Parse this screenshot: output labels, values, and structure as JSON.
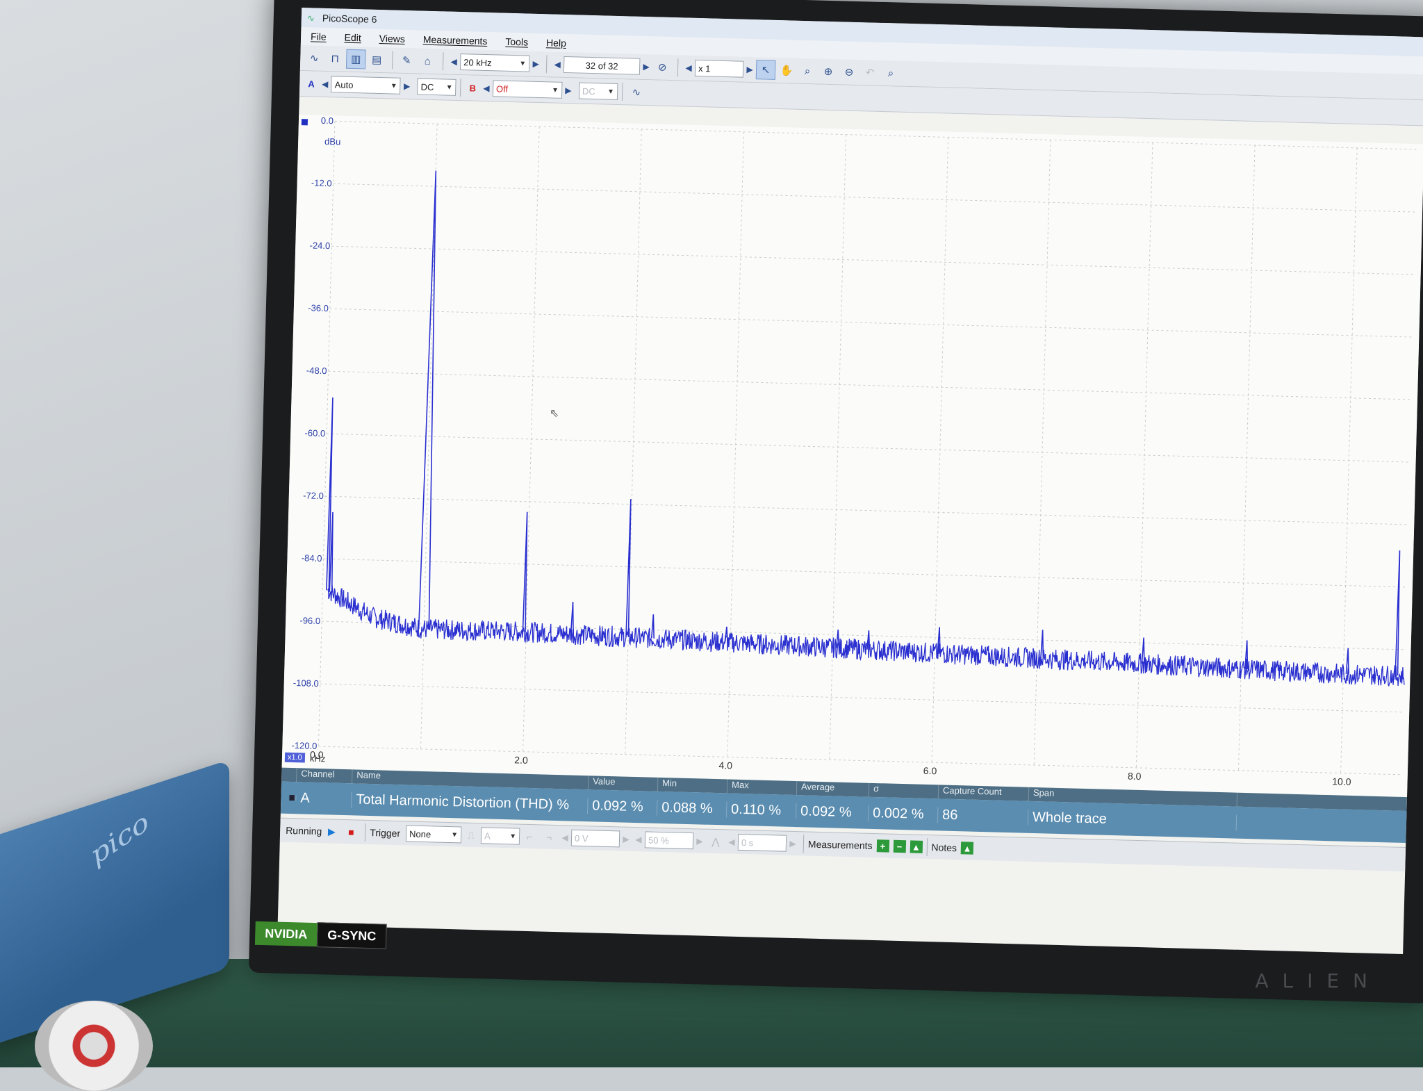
{
  "window": {
    "title": "PicoScope 6"
  },
  "menu": [
    "File",
    "Edit",
    "Views",
    "Measurements",
    "Tools",
    "Help"
  ],
  "toolbar": {
    "timebase": "20 kHz",
    "capture_index": "32 of 32",
    "zoom": "x 1",
    "channel_a_label": "A",
    "channel_a_range": "Auto",
    "channel_a_coupling": "DC",
    "channel_b_label": "B",
    "channel_b_range": "Off",
    "channel_b_coupling": "DC"
  },
  "plot": {
    "y_unit": "dBu",
    "x_unit": "kHz",
    "scale_tag": "x1.0",
    "y_ticks": [
      "0.0",
      "-12.0",
      "-24.0",
      "-36.0",
      "-48.0",
      "-60.0",
      "-72.0",
      "-84.0",
      "-96.0",
      "-108.0",
      "-120.0"
    ],
    "x_ticks": [
      "0.0",
      "2.0",
      "4.0",
      "6.0",
      "8.0",
      "10.0"
    ]
  },
  "chart_data": {
    "type": "line",
    "title": "",
    "xlabel": "kHz",
    "ylabel": "dBu",
    "xlim": [
      0,
      10.6
    ],
    "ylim": [
      -120,
      0
    ],
    "grid": true,
    "noise_floor": [
      [
        0.05,
        -90
      ],
      [
        0.5,
        -95
      ],
      [
        1.0,
        -97
      ],
      [
        2.0,
        -97
      ],
      [
        4.0,
        -98
      ],
      [
        6.0,
        -99
      ],
      [
        8.0,
        -100
      ],
      [
        10.0,
        -101
      ],
      [
        10.6,
        -101
      ]
    ],
    "peaks": [
      {
        "x": 0.05,
        "y": -53
      },
      {
        "x": 0.08,
        "y": -75
      },
      {
        "x": 1.0,
        "y": -9
      },
      {
        "x": 1.98,
        "y": -74
      },
      {
        "x": 2.45,
        "y": -91
      },
      {
        "x": 2.99,
        "y": -71
      },
      {
        "x": 3.24,
        "y": -93
      },
      {
        "x": 3.96,
        "y": -95
      },
      {
        "x": 5.05,
        "y": -95
      },
      {
        "x": 5.35,
        "y": -95
      },
      {
        "x": 6.04,
        "y": -94
      },
      {
        "x": 7.05,
        "y": -94
      },
      {
        "x": 8.04,
        "y": -95
      },
      {
        "x": 9.05,
        "y": -95
      },
      {
        "x": 10.04,
        "y": -96
      },
      {
        "x": 10.52,
        "y": -77
      }
    ]
  },
  "measurements": {
    "headers": [
      "Channel",
      "Name",
      "Value",
      "Min",
      "Max",
      "Average",
      "σ",
      "Capture Count",
      "Span"
    ],
    "rows": [
      {
        "channel": "A",
        "name": "Total Harmonic Distortion (THD) %",
        "value": "0.092 %",
        "min": "0.088 %",
        "max": "0.110 %",
        "average": "0.092 %",
        "sigma": "0.002 %",
        "capture_count": "86",
        "span": "Whole trace"
      }
    ]
  },
  "status": {
    "running": "Running",
    "trigger_label": "Trigger",
    "trigger_mode": "None",
    "trigger_channel": "A",
    "trigger_level": "0 V",
    "trigger_pos": "50 %",
    "trigger_delay": "0 s",
    "measurements_label": "Measurements",
    "notes_label": "Notes"
  },
  "monitor": {
    "nvidia": "NVIDIA",
    "gsync": "G-SYNC",
    "brand": "ALIEN"
  },
  "device": {
    "logo": "pico"
  },
  "colors": {
    "trace": "#2a2fd0",
    "grid": "#c8ccc8",
    "meas_row": "#5b8db0",
    "meas_header": "#4d6e84"
  }
}
